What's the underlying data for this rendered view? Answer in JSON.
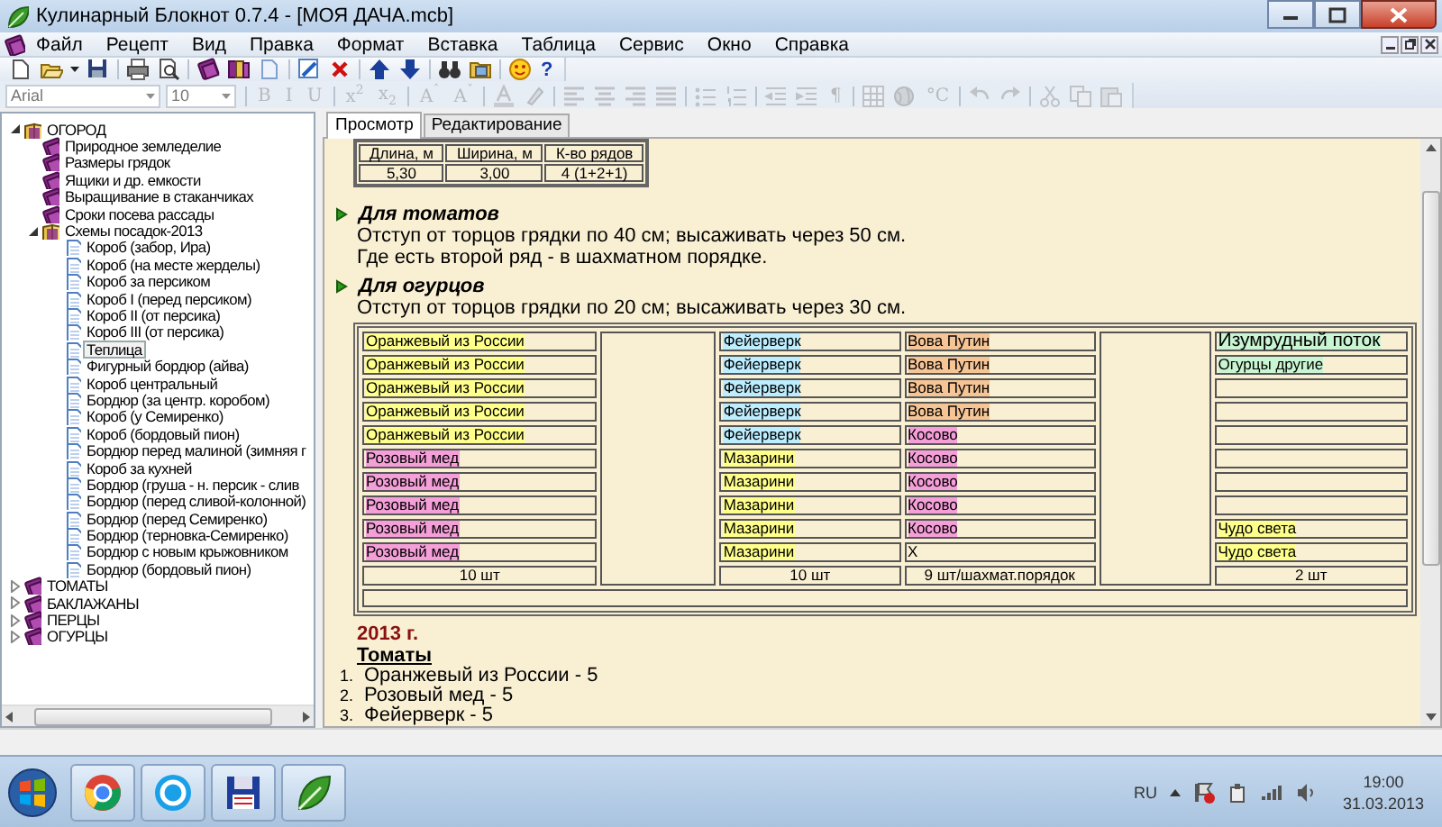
{
  "window": {
    "title": "Кулинарный Блокнот 0.7.4 - [МОЯ ДАЧА.mcb]"
  },
  "menu": [
    "Файл",
    "Рецепт",
    "Вид",
    "Правка",
    "Формат",
    "Вставка",
    "Таблица",
    "Сервис",
    "Окно",
    "Справка"
  ],
  "toolbar": {
    "help_glyph": "?"
  },
  "format_toolbar": {
    "disabled": true,
    "font": "Arial",
    "size": "10",
    "glyphs": [
      "B",
      "I",
      "U",
      "x$^{2}$",
      "x$_{2}$",
      "A$^{ˆ}$",
      "A$^{ˇ}$"
    ],
    "pilcrow": "¶",
    "unit": "°C"
  },
  "tree": [
    {
      "label": "ОГОРОД",
      "kind": "folder",
      "expanded": true,
      "selected": false,
      "children": [
        {
          "label": "Природное земледелие",
          "kind": "book",
          "selected": false
        },
        {
          "label": "Размеры грядок",
          "kind": "book",
          "selected": false
        },
        {
          "label": "Ящики и др. емкости",
          "kind": "book",
          "selected": false
        },
        {
          "label": "Выращивание в стаканчиках",
          "kind": "book",
          "selected": false
        },
        {
          "label": "Сроки посева рассады",
          "kind": "book",
          "selected": false
        },
        {
          "label": "Схемы посадок-2013",
          "kind": "folder",
          "expanded": true,
          "selected": false,
          "children": [
            {
              "label": "Короб (забор, Ира)",
              "kind": "page",
              "selected": false
            },
            {
              "label": "Короб (на месте жерделы)",
              "kind": "page",
              "selected": false
            },
            {
              "label": "Короб за персиком",
              "kind": "page",
              "selected": false
            },
            {
              "label": "Короб I (перед персиком)",
              "kind": "page",
              "selected": false
            },
            {
              "label": "Короб II (от персика)",
              "kind": "page",
              "selected": false
            },
            {
              "label": "Короб III (от персика)",
              "kind": "page",
              "selected": false
            },
            {
              "label": "Теплица",
              "kind": "page",
              "selected": true
            },
            {
              "label": "Фигурный бордюр (айва)",
              "kind": "page",
              "selected": false
            },
            {
              "label": "Короб центральный",
              "kind": "page",
              "selected": false
            },
            {
              "label": "Бордюр (за центр. коробом)",
              "kind": "page",
              "selected": false
            },
            {
              "label": "Короб (у Семиренко)",
              "kind": "page",
              "selected": false
            },
            {
              "label": "Короб (бордовый пион)",
              "kind": "page",
              "selected": false
            },
            {
              "label": "Бордюр перед малиной (зимняя г",
              "kind": "page",
              "selected": false
            },
            {
              "label": "Короб за кухней",
              "kind": "page",
              "selected": false
            },
            {
              "label": "Бордюр (груша - н. персик - слив",
              "kind": "page",
              "selected": false
            },
            {
              "label": "Бордюр (перед сливой-колонной)",
              "kind": "page",
              "selected": false
            },
            {
              "label": "Бордюр (перед Семиренко)",
              "kind": "page",
              "selected": false
            },
            {
              "label": "Бордюр (терновка-Семиренко)",
              "kind": "page",
              "selected": false
            },
            {
              "label": "Бордюр с новым крыжовником",
              "kind": "page",
              "selected": false
            },
            {
              "label": "Бордюр (бордовый пион)",
              "kind": "page",
              "selected": false
            }
          ]
        }
      ]
    },
    {
      "label": "ТОМАТЫ",
      "kind": "book",
      "expanded": false,
      "selected": false
    },
    {
      "label": "БАКЛАЖАНЫ",
      "kind": "book",
      "expanded": false,
      "selected": false
    },
    {
      "label": "ПЕРЦЫ",
      "kind": "book",
      "expanded": false,
      "selected": false
    },
    {
      "label": "ОГУРЦЫ",
      "kind": "book",
      "expanded": false,
      "selected": false
    }
  ],
  "tabs": [
    {
      "label": "Просмотр",
      "selected": true
    },
    {
      "label": "Редактирование",
      "selected": false
    }
  ],
  "info_table": {
    "columns": [
      "Длина, м",
      "Ширина, м",
      "К-во рядов"
    ],
    "rows": [
      [
        "5,30",
        "3,00",
        "4 (1+2+1)"
      ]
    ]
  },
  "sections": [
    {
      "title": "Для томатов",
      "lines": [
        "Отступ от торцов грядки по 40 см; высаживать через 50 см.",
        "Где есть второй ряд - в шахматном порядке."
      ]
    },
    {
      "title": "Для огурцов",
      "lines": [
        "Отступ от торцов грядки по 20 см; высаживать через 30 см."
      ]
    }
  ],
  "planting_table": {
    "rows": [
      {
        "cells": [
          {
            "text": "Оранжевый из России",
            "color": "#ffff8c"
          },
          {
            "text": "Фейерверк",
            "color": "#bdeeff"
          },
          {
            "text": "Вова Путин",
            "color": "#f6c596"
          },
          {
            "text": "Изумрудный поток",
            "color": "#c9f5d2",
            "large": true
          }
        ]
      },
      {
        "cells": [
          {
            "text": "Оранжевый из России",
            "color": "#ffff8c"
          },
          {
            "text": "Фейерверк",
            "color": "#bdeeff"
          },
          {
            "text": "Вова Путин",
            "color": "#f6c596"
          },
          {
            "text": "Огурцы другие",
            "color": "#c9f5d2"
          }
        ]
      },
      {
        "cells": [
          {
            "text": "Оранжевый из России",
            "color": "#ffff8c"
          },
          {
            "text": "Фейерверк",
            "color": "#bdeeff"
          },
          {
            "text": "Вова Путин",
            "color": "#f6c596"
          },
          null
        ]
      },
      {
        "cells": [
          {
            "text": "Оранжевый из России",
            "color": "#ffff8c"
          },
          {
            "text": "Фейерверк",
            "color": "#bdeeff"
          },
          {
            "text": "Вова Путин",
            "color": "#f6c596"
          },
          null
        ]
      },
      {
        "cells": [
          {
            "text": "Оранжевый из России",
            "color": "#ffff8c"
          },
          {
            "text": "Фейерверк",
            "color": "#bdeeff"
          },
          {
            "text": "Косово",
            "color": "#f59fd9"
          },
          null
        ]
      },
      {
        "cells": [
          {
            "text": "Розовый мед",
            "color": "#f59fd9"
          },
          {
            "text": "Мазарини",
            "color": "#ffff8c"
          },
          {
            "text": "Косово",
            "color": "#f59fd9"
          },
          null
        ]
      },
      {
        "cells": [
          {
            "text": "Розовый мед",
            "color": "#f59fd9"
          },
          {
            "text": "Мазарини",
            "color": "#ffff8c"
          },
          {
            "text": "Косово",
            "color": "#f59fd9"
          },
          null
        ]
      },
      {
        "cells": [
          {
            "text": "Розовый мед",
            "color": "#f59fd9"
          },
          {
            "text": "Мазарини",
            "color": "#ffff8c"
          },
          {
            "text": "Косово",
            "color": "#f59fd9"
          },
          null
        ]
      },
      {
        "cells": [
          {
            "text": "Розовый мед",
            "color": "#f59fd9"
          },
          {
            "text": "Мазарини",
            "color": "#ffff8c"
          },
          {
            "text": "Косово",
            "color": "#f59fd9"
          },
          {
            "text": "Чудо света",
            "color": "#ffff8c"
          }
        ]
      },
      {
        "cells": [
          {
            "text": "Розовый мед",
            "color": "#f59fd9"
          },
          {
            "text": "Мазарини",
            "color": "#ffff8c"
          },
          {
            "text": "X"
          },
          {
            "text": "Чудо света",
            "color": "#ffff8c"
          }
        ]
      }
    ],
    "totals": [
      "10 шт",
      "10 шт",
      "9 шт/шахмат.порядок",
      "2 шт"
    ]
  },
  "summary": {
    "year": "2013 г.",
    "heading": "Томаты",
    "items": [
      {
        "number": "1.",
        "text": "Оранжевый из России - 5"
      },
      {
        "number": "2.",
        "text": "Розовый мед - 5"
      },
      {
        "number": "3.",
        "text": "Фейерверк - 5"
      }
    ]
  },
  "taskbar": {
    "language": "RU",
    "time": "19:00",
    "date": "31.03.2013"
  }
}
